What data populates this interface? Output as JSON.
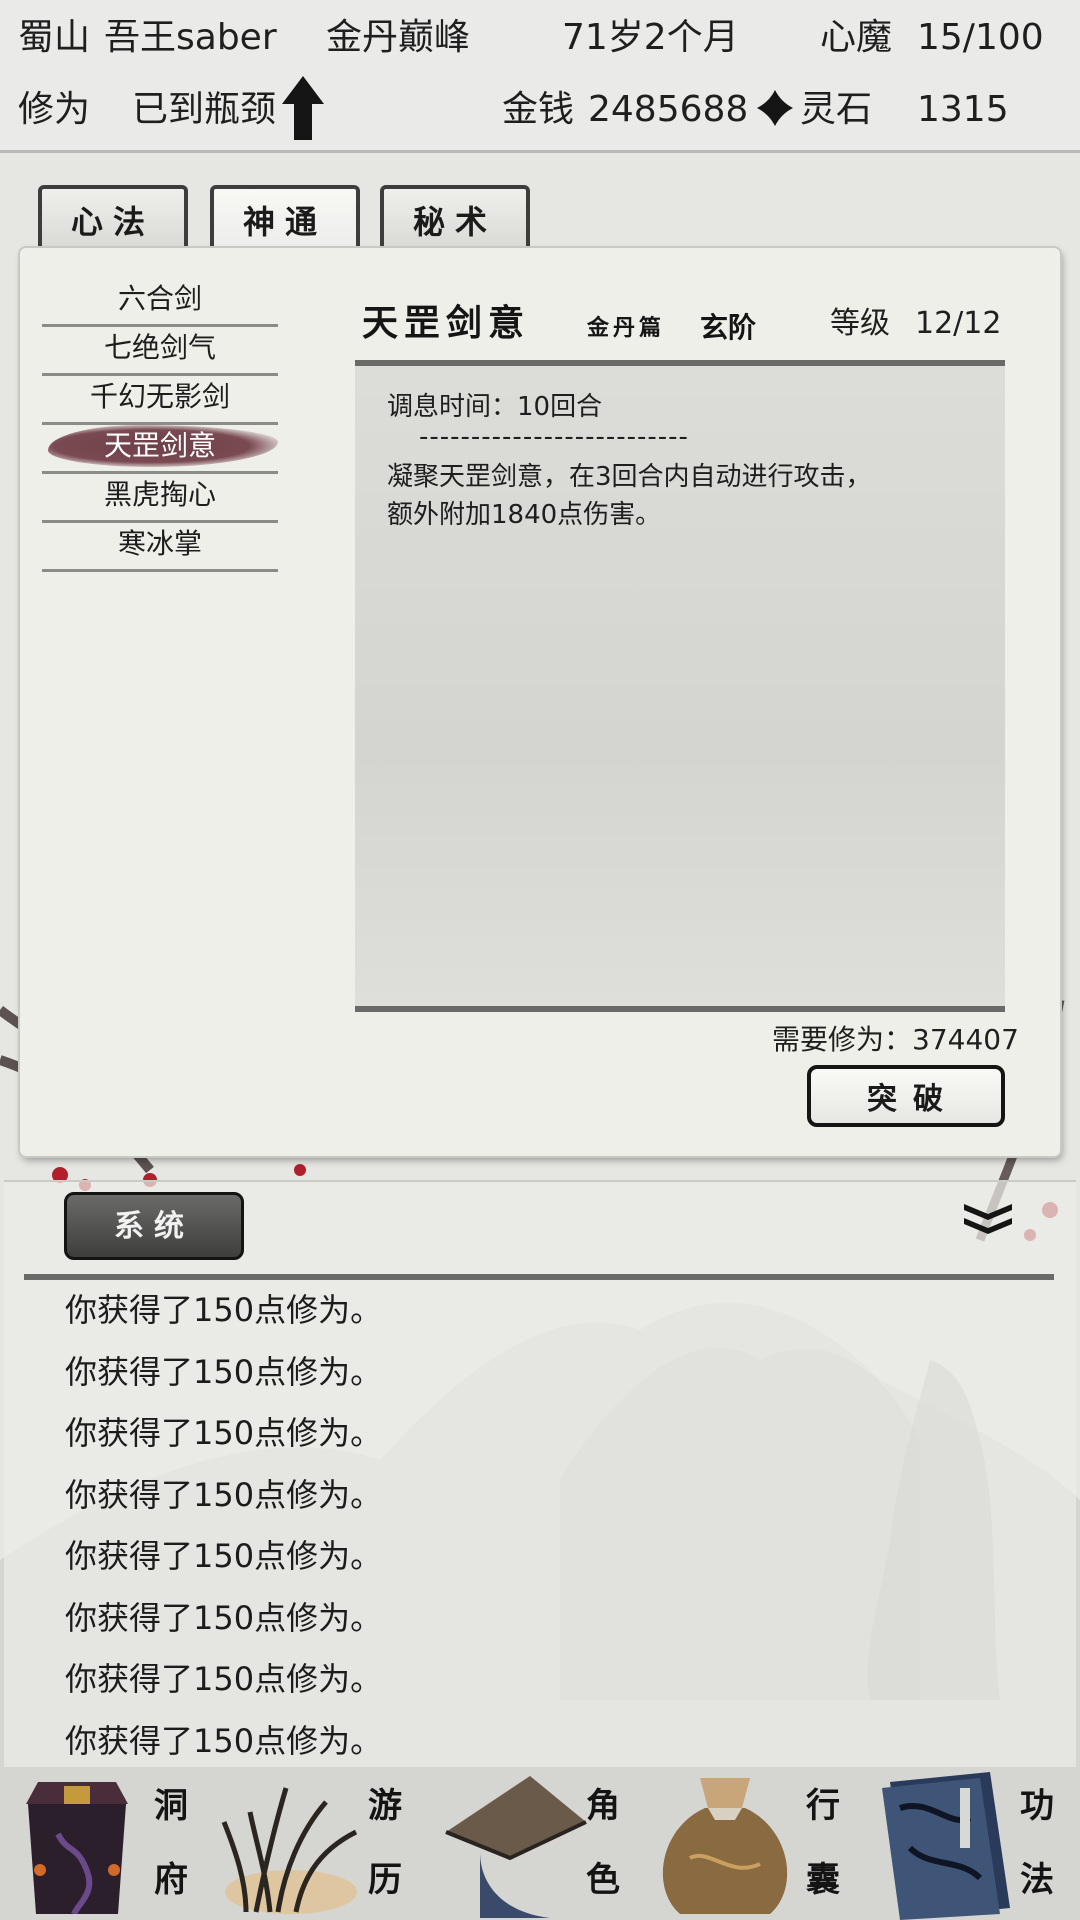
{
  "status": {
    "location": "蜀山",
    "player_name": "吾王saber",
    "realm": "金丹巅峰",
    "age": "71岁2个月",
    "heart_demon_label": "心魔",
    "heart_demon_value": "15/100",
    "cultivation_label": "修为",
    "cultivation_value": "已到瓶颈",
    "money_label": "金钱",
    "money_value": "2485688",
    "spirit_stone_label": "灵石",
    "spirit_stone_value": "1315"
  },
  "tabs": [
    "心法",
    "神通",
    "秘术"
  ],
  "active_tab": "神通",
  "skills": [
    "六合剑",
    "七绝剑气",
    "千幻无影剑",
    "天罡剑意",
    "黑虎掏心",
    "寒冰掌"
  ],
  "selected_skill": "天罡剑意",
  "detail": {
    "name": "天罡剑意",
    "chapter": "金丹篇",
    "grade": "玄阶",
    "level_label": "等级",
    "level_value": "12/12",
    "cooldown": "调息时间：10回合",
    "divider": "--------------------------",
    "description_line1": "凝聚天罡剑意，在3回合内自动进行攻击，",
    "description_line2": "额外附加1840点伤害。",
    "required": "需要修为：374407",
    "breakthrough_button": "突破"
  },
  "log": {
    "channel_button": "系统",
    "messages": [
      "你获得了150点修为。",
      "你获得了150点修为。",
      "你获得了150点修为。",
      "你获得了150点修为。",
      "你获得了150点修为。",
      "你获得了150点修为。",
      "你获得了150点修为。",
      "你获得了150点修为。"
    ]
  },
  "bottom_nav": [
    {
      "label_top": "洞",
      "label_bottom": "府"
    },
    {
      "label_top": "游",
      "label_bottom": "历"
    },
    {
      "label_top": "角",
      "label_bottom": "色"
    },
    {
      "label_top": "行",
      "label_bottom": "囊"
    },
    {
      "label_top": "功",
      "label_bottom": "法"
    }
  ],
  "colors": {
    "selected_brush": "#7a4a52",
    "panel": "#efefea",
    "ink": "#1b1b1b"
  }
}
